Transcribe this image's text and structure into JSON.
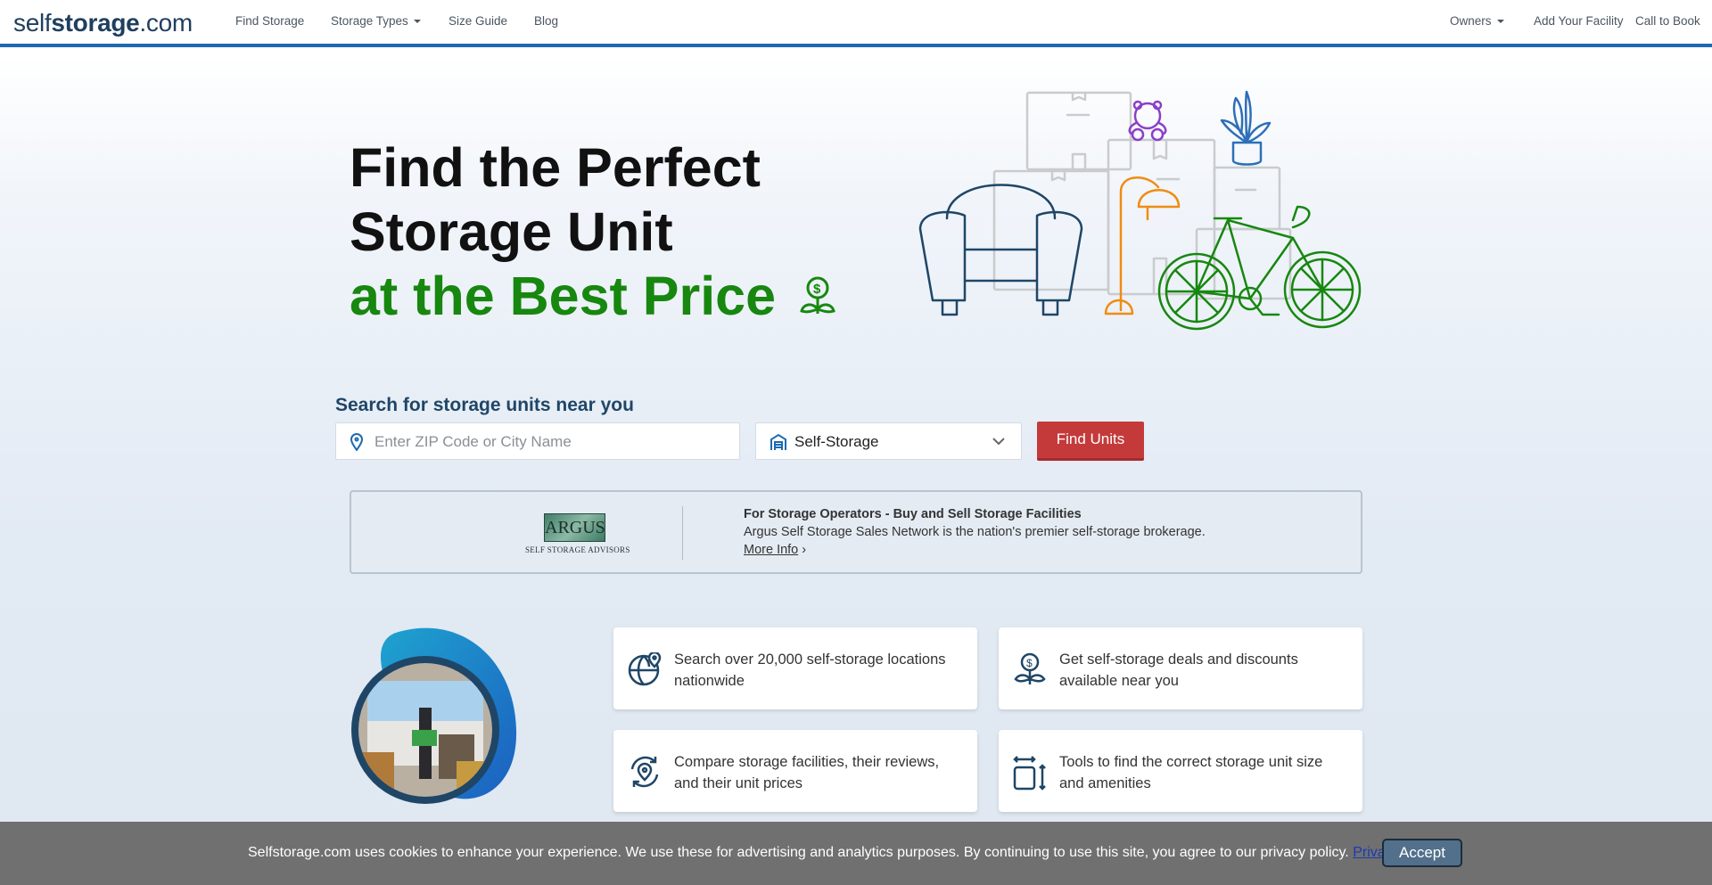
{
  "header": {
    "logo_pre": "self",
    "logo_bold": "storage",
    "logo_post": ".com",
    "nav": [
      "Find Storage",
      "Storage Types",
      "Size Guide",
      "Blog"
    ],
    "right_nav": [
      "Owners",
      "Add Your Facility",
      "Call to Book"
    ]
  },
  "hero": {
    "line1": "Find the Perfect",
    "line2": "Storage Unit",
    "line3": "at the Best Price"
  },
  "search": {
    "label": "Search for storage units near you",
    "placeholder": "Enter ZIP Code or City Name",
    "type_value": "Self-Storage",
    "button": "Find Units"
  },
  "ad": {
    "logo_text": "ARGUS",
    "logo_sub": "SELF STORAGE ADVISORS",
    "title": "For Storage Operators - Buy and Sell Storage Facilities",
    "desc": "Argus Self Storage Sales Network is the nation's premier self-storage brokerage.",
    "link": "More Info"
  },
  "features": [
    {
      "icon": "globe-pin-icon",
      "text": "Search over 20,000 self-storage locations nationwide"
    },
    {
      "icon": "dollar-hand-icon",
      "text": "Get self-storage deals and discounts available near you"
    },
    {
      "icon": "compare-pin-icon",
      "text": "Compare storage facilities, their reviews, and their unit prices"
    },
    {
      "icon": "size-tools-icon",
      "text": "Tools to find the correct storage unit size and amenities"
    }
  ],
  "cookie": {
    "text": "Selfstorage.com uses cookies to enhance your experience. We use these for advertising and analytics purposes. By continuing to use this site, you agree to our privacy policy.",
    "link": "Privacy Policy",
    "accept": "Accept"
  },
  "colors": {
    "brand_blue": "#1d6ab0",
    "accent_green": "#17870f",
    "button_red": "#c43a3a"
  }
}
